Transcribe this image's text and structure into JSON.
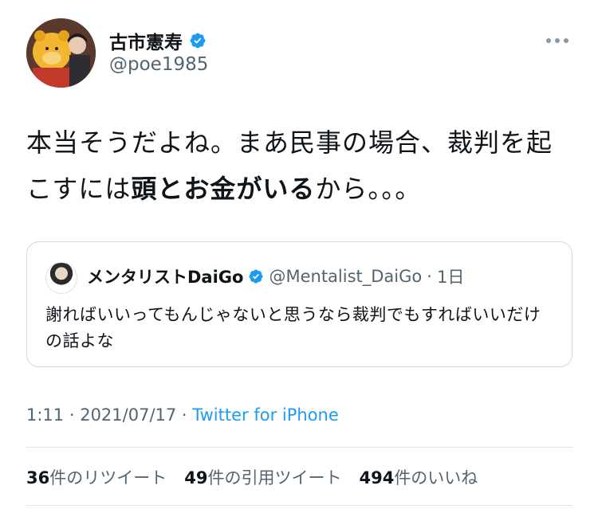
{
  "tweet": {
    "author": {
      "display_name": "古市憲寿",
      "handle": "@poe1985",
      "verified": true
    },
    "text_plain_1": "本当そうだよね。まあ民事の場合、裁判を起こすには",
    "text_bold": "頭とお金がいる",
    "text_plain_2": "から。。。",
    "quote": {
      "display_name": "メンタリストDaiGo",
      "handle": "@Mentalist_DaiGo",
      "separator": "·",
      "time": "1日",
      "text": "謝ればいいってもんじゃないと思うなら裁判でもすればいいだけの話よな"
    },
    "meta": {
      "time": "1:11",
      "sep1": " · ",
      "date": "2021/07/17",
      "sep2": " · ",
      "source": "Twitter for iPhone"
    },
    "stats": {
      "retweets_count": "36",
      "retweets_label": "件のリツイート",
      "quotes_count": "49",
      "quotes_label": "件の引用ツイート",
      "likes_count": "494",
      "likes_label": "件のいいね"
    }
  },
  "colors": {
    "accent": "#1d9bf0",
    "secondary_text": "#536471",
    "border": "#cfd9de"
  },
  "icons": [
    "verified-badge-icon",
    "more-options-icon"
  ]
}
